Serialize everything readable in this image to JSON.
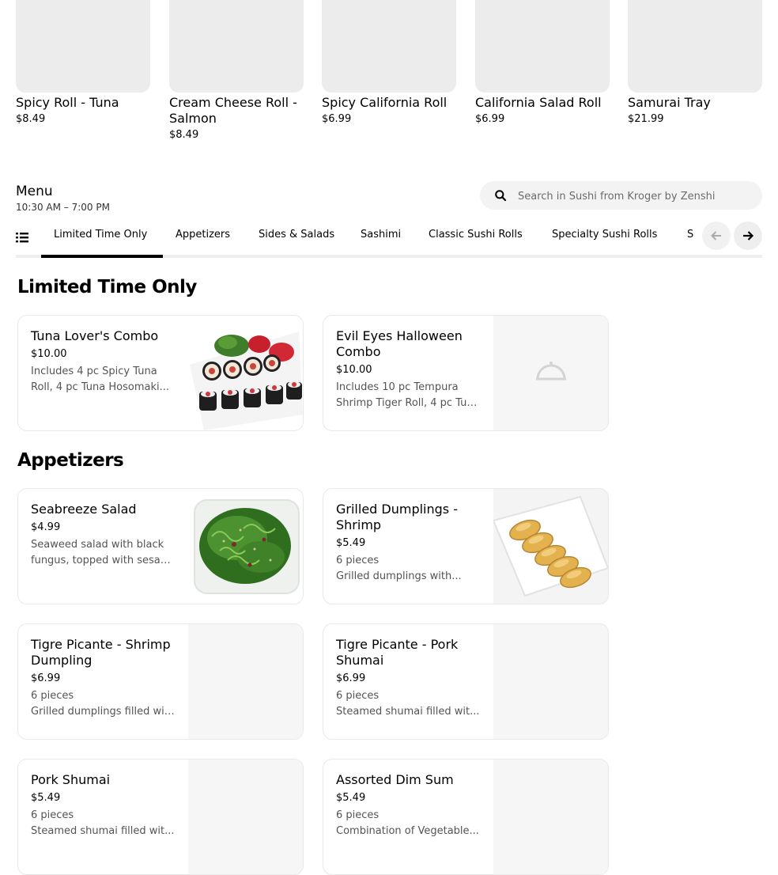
{
  "featured": [
    {
      "name": "Spicy Roll - Tuna",
      "price": "$8.49"
    },
    {
      "name": "Cream Cheese Roll - Salmon",
      "price": "$8.49"
    },
    {
      "name": "Spicy California Roll",
      "price": "$6.99"
    },
    {
      "name": "California Salad Roll",
      "price": "$6.99"
    },
    {
      "name": "Samurai Tray",
      "price": "$21.99"
    }
  ],
  "menu": {
    "title": "Menu",
    "hours": "10:30 AM – 7:00 PM",
    "search_placeholder": "Search in Sushi from Kroger by Zenshi"
  },
  "tabs": [
    "Limited Time Only",
    "Appetizers",
    "Sides & Salads",
    "Sashimi",
    "Classic Sushi Rolls",
    "Specialty Sushi Rolls",
    "S"
  ],
  "sections": {
    "limited": {
      "title": "Limited Time Only",
      "items": [
        {
          "name": "Tuna Lover's Combo",
          "price": "$10.00",
          "desc1": "Includes 4 pc Spicy Tuna",
          "desc2": "Roll, 4 pc Tuna Hosomaki..."
        },
        {
          "name": "Evil Eyes Halloween Combo",
          "price": "$10.00",
          "desc1": "Includes 10 pc Tempura",
          "desc2": "Shrimp Tiger Roll, 4 pc Tun..."
        }
      ]
    },
    "appetizers": {
      "title": "Appetizers",
      "items": [
        {
          "name": "Seabreeze Salad",
          "price": "$4.99",
          "desc1": "Seaweed salad with black",
          "desc2": "fungus, topped with sesam..."
        },
        {
          "name": "Grilled Dumplings - Shrimp",
          "price": "$5.49",
          "desc1": "6 pieces",
          "desc2": "Grilled dumplings with..."
        },
        {
          "name": "Tigre Picante - Shrimp Dumpling",
          "price": "$6.99",
          "desc1": "6 pieces",
          "desc2": "Grilled dumplings filled wit..."
        },
        {
          "name": "Tigre Picante - Pork Shumai",
          "price": "$6.99",
          "desc1": "6 pieces",
          "desc2": "Steamed shumai filled wit..."
        },
        {
          "name": "Pork Shumai",
          "price": "$5.49",
          "desc1": "6 pieces",
          "desc2": "Steamed shumai filled wit..."
        },
        {
          "name": "Assorted Dim Sum",
          "price": "$5.49",
          "desc1": "6 pieces",
          "desc2": "Combination of Vegetable..."
        }
      ]
    }
  }
}
